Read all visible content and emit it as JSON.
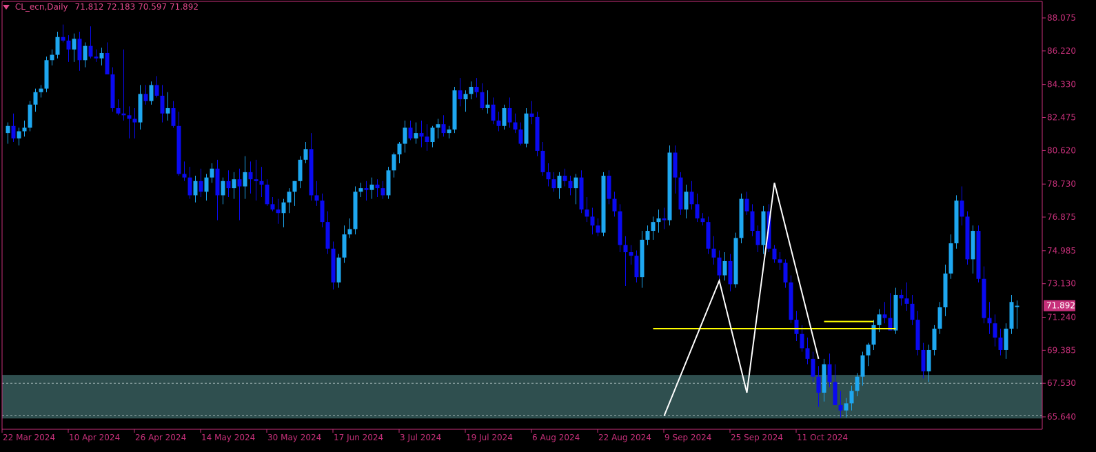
{
  "header": {
    "symbol": "CL_ecn,Daily",
    "open": "71.812",
    "high": "72.183",
    "low": "70.597",
    "close": "71.892"
  },
  "colors": {
    "background": "#000000",
    "axis": "#c7307a",
    "bull_candle": "#1ea7f0",
    "bear_candle": "#0a0af0",
    "zone_fill": "#2f4f4f",
    "zigzag": "#ffffff",
    "level_line": "#ffff00",
    "price_tag_bg": "#c7307a"
  },
  "chart_data": {
    "type": "candlestick",
    "y_ticks": [
      "88.075",
      "86.220",
      "84.330",
      "82.475",
      "80.620",
      "78.730",
      "76.875",
      "74.985",
      "73.130",
      "71.240",
      "69.385",
      "67.530",
      "65.640"
    ],
    "x_ticks": [
      {
        "label": "22 Mar 2024",
        "index": 0
      },
      {
        "label": "10 Apr 2024",
        "index": 12
      },
      {
        "label": "26 Apr 2024",
        "index": 24
      },
      {
        "label": "14 May 2024",
        "index": 36
      },
      {
        "label": "30 May 2024",
        "index": 48
      },
      {
        "label": "17 Jun 2024",
        "index": 60
      },
      {
        "label": "3 Jul 2024",
        "index": 72
      },
      {
        "label": "19 Jul 2024",
        "index": 84
      },
      {
        "label": "6 Aug 2024",
        "index": 96
      },
      {
        "label": "22 Aug 2024",
        "index": 108
      },
      {
        "label": "9 Sep 2024",
        "index": 120
      },
      {
        "label": "25 Sep 2024",
        "index": 132
      },
      {
        "label": "11 Oct 2024",
        "index": 144
      }
    ],
    "ylim": [
      65.0,
      88.8
    ],
    "current_price": "71.892",
    "demand_zone": {
      "top": 68.0,
      "bottom": 65.55,
      "dashed_levels": [
        67.53,
        65.7
      ]
    },
    "zigzag": [
      {
        "index": 119,
        "price": 65.7
      },
      {
        "index": 129,
        "price": 73.3
      },
      {
        "index": 134,
        "price": 67.0
      },
      {
        "index": 139,
        "price": 78.8
      },
      {
        "index": 147,
        "price": 68.9
      }
    ],
    "levels": [
      {
        "price": 70.6,
        "from_index": 117,
        "to_index": 161
      },
      {
        "price": 71.0,
        "from_index": 148,
        "to_index": 157
      }
    ],
    "candles": [
      [
        81.6,
        82.2,
        81.0,
        82.0
      ],
      [
        82.0,
        82.7,
        81.1,
        81.3
      ],
      [
        81.3,
        81.9,
        80.9,
        81.7
      ],
      [
        81.7,
        82.3,
        81.4,
        81.9
      ],
      [
        81.9,
        83.4,
        81.7,
        83.2
      ],
      [
        83.2,
        84.1,
        82.8,
        83.9
      ],
      [
        83.9,
        84.3,
        83.6,
        84.1
      ],
      [
        84.1,
        85.9,
        83.9,
        85.7
      ],
      [
        85.7,
        86.3,
        85.4,
        86.0
      ],
      [
        86.0,
        87.3,
        85.8,
        87.0
      ],
      [
        87.0,
        87.7,
        86.7,
        86.8
      ],
      [
        86.8,
        87.1,
        85.6,
        86.3
      ],
      [
        86.3,
        87.2,
        85.6,
        86.9
      ],
      [
        86.9,
        87.3,
        85.1,
        85.7
      ],
      [
        85.7,
        86.7,
        85.3,
        86.5
      ],
      [
        86.5,
        87.6,
        85.8,
        85.9
      ],
      [
        85.9,
        86.3,
        85.6,
        85.8
      ],
      [
        85.8,
        86.4,
        85.4,
        86.1
      ],
      [
        86.1,
        86.7,
        85.0,
        84.9
      ],
      [
        84.9,
        85.3,
        82.8,
        83.0
      ],
      [
        83.0,
        83.5,
        82.6,
        82.7
      ],
      [
        82.7,
        86.3,
        82.3,
        82.6
      ],
      [
        82.6,
        83.1,
        81.3,
        82.4
      ],
      [
        82.4,
        83.0,
        81.3,
        82.2
      ],
      [
        82.2,
        84.3,
        81.8,
        83.8
      ],
      [
        83.8,
        84.3,
        83.2,
        83.4
      ],
      [
        83.4,
        84.5,
        83.2,
        84.3
      ],
      [
        84.3,
        84.8,
        83.6,
        83.7
      ],
      [
        83.7,
        84.3,
        82.2,
        82.7
      ],
      [
        82.7,
        83.9,
        82.3,
        83.0
      ],
      [
        83.0,
        83.4,
        81.9,
        82.0
      ],
      [
        82.0,
        82.8,
        79.2,
        79.3
      ],
      [
        79.3,
        80.0,
        78.9,
        79.1
      ],
      [
        79.1,
        79.7,
        77.9,
        78.1
      ],
      [
        78.1,
        79.2,
        77.7,
        78.9
      ],
      [
        78.9,
        79.6,
        78.0,
        78.3
      ],
      [
        78.3,
        79.3,
        77.8,
        79.1
      ],
      [
        79.1,
        79.9,
        78.8,
        79.6
      ],
      [
        79.6,
        80.1,
        76.7,
        78.1
      ],
      [
        78.1,
        79.1,
        77.6,
        78.9
      ],
      [
        78.9,
        79.5,
        78.0,
        78.5
      ],
      [
        78.5,
        79.4,
        77.9,
        79.0
      ],
      [
        79.0,
        79.6,
        76.7,
        78.6
      ],
      [
        78.6,
        80.3,
        77.9,
        79.4
      ],
      [
        79.4,
        80.0,
        78.2,
        79.0
      ],
      [
        79.0,
        80.1,
        77.8,
        78.9
      ],
      [
        78.9,
        79.7,
        78.0,
        78.7
      ],
      [
        78.7,
        79.0,
        77.5,
        77.6
      ],
      [
        77.6,
        78.0,
        77.2,
        77.3
      ],
      [
        77.3,
        77.9,
        76.5,
        77.1
      ],
      [
        77.1,
        77.9,
        76.3,
        77.7
      ],
      [
        77.7,
        78.5,
        77.1,
        78.3
      ],
      [
        78.3,
        78.9,
        77.5,
        78.9
      ],
      [
        78.9,
        80.3,
        78.5,
        80.1
      ],
      [
        80.1,
        81.1,
        79.9,
        80.7
      ],
      [
        80.7,
        81.6,
        77.8,
        78.1
      ],
      [
        78.1,
        78.9,
        77.5,
        77.8
      ],
      [
        77.8,
        78.2,
        76.3,
        76.6
      ],
      [
        76.6,
        77.2,
        74.8,
        75.1
      ],
      [
        75.1,
        75.5,
        72.8,
        73.2
      ],
      [
        73.2,
        74.8,
        72.9,
        74.6
      ],
      [
        74.6,
        76.4,
        74.3,
        75.9
      ],
      [
        75.9,
        76.8,
        75.7,
        76.2
      ],
      [
        76.2,
        78.6,
        75.9,
        78.3
      ],
      [
        78.3,
        78.8,
        78.0,
        78.5
      ],
      [
        78.5,
        78.9,
        77.8,
        78.4
      ],
      [
        78.4,
        79.1,
        77.9,
        78.7
      ],
      [
        78.7,
        79.0,
        78.0,
        78.5
      ],
      [
        78.5,
        78.9,
        77.9,
        78.1
      ],
      [
        78.1,
        79.7,
        77.9,
        79.5
      ],
      [
        79.5,
        80.5,
        79.1,
        80.4
      ],
      [
        80.4,
        81.1,
        79.9,
        81.0
      ],
      [
        81.0,
        82.3,
        80.5,
        81.9
      ],
      [
        81.9,
        82.3,
        81.2,
        81.3
      ],
      [
        81.3,
        82.2,
        81.0,
        81.6
      ],
      [
        81.6,
        82.3,
        80.8,
        81.4
      ],
      [
        81.4,
        82.1,
        80.6,
        81.1
      ],
      [
        81.1,
        82.0,
        80.8,
        81.9
      ],
      [
        81.9,
        82.4,
        81.3,
        82.1
      ],
      [
        82.1,
        82.6,
        81.4,
        81.6
      ],
      [
        81.6,
        82.0,
        81.3,
        81.8
      ],
      [
        81.8,
        84.2,
        81.6,
        84.0
      ],
      [
        84.0,
        84.7,
        83.1,
        83.5
      ],
      [
        83.5,
        84.0,
        82.8,
        83.8
      ],
      [
        83.8,
        84.5,
        83.5,
        84.2
      ],
      [
        84.2,
        84.7,
        83.6,
        83.9
      ],
      [
        83.9,
        84.4,
        82.9,
        83.0
      ],
      [
        83.0,
        84.0,
        82.7,
        83.2
      ],
      [
        83.2,
        83.6,
        82.1,
        82.3
      ],
      [
        82.3,
        82.8,
        81.7,
        82.0
      ],
      [
        82.0,
        83.2,
        81.8,
        83.0
      ],
      [
        83.0,
        83.6,
        81.9,
        82.2
      ],
      [
        82.2,
        82.7,
        81.6,
        81.8
      ],
      [
        81.8,
        82.2,
        80.9,
        81.0
      ],
      [
        81.0,
        83.0,
        80.8,
        82.7
      ],
      [
        82.7,
        83.4,
        82.1,
        82.5
      ],
      [
        82.5,
        82.8,
        80.3,
        80.6
      ],
      [
        80.6,
        81.1,
        79.2,
        79.4
      ],
      [
        79.4,
        79.9,
        78.6,
        79.0
      ],
      [
        79.0,
        79.4,
        78.3,
        78.5
      ],
      [
        78.5,
        79.4,
        77.9,
        79.2
      ],
      [
        79.2,
        79.6,
        78.6,
        78.9
      ],
      [
        78.9,
        79.2,
        78.1,
        78.5
      ],
      [
        78.5,
        79.3,
        77.6,
        79.1
      ],
      [
        79.1,
        79.5,
        77.1,
        77.3
      ],
      [
        77.3,
        78.0,
        76.6,
        76.9
      ],
      [
        76.9,
        77.4,
        75.9,
        76.4
      ],
      [
        76.4,
        76.8,
        75.8,
        76.0
      ],
      [
        76.0,
        79.4,
        75.8,
        79.2
      ],
      [
        79.2,
        79.5,
        77.6,
        77.9
      ],
      [
        77.9,
        78.3,
        76.9,
        77.2
      ],
      [
        77.2,
        77.6,
        74.9,
        75.3
      ],
      [
        75.3,
        75.8,
        73.0,
        74.9
      ],
      [
        74.9,
        75.3,
        74.2,
        74.7
      ],
      [
        74.7,
        75.0,
        73.2,
        73.5
      ],
      [
        73.5,
        76.1,
        72.9,
        75.6
      ],
      [
        75.6,
        76.4,
        75.3,
        76.1
      ],
      [
        76.1,
        76.9,
        75.6,
        76.6
      ],
      [
        76.6,
        77.3,
        76.0,
        76.8
      ],
      [
        76.8,
        77.4,
        76.2,
        76.7
      ],
      [
        76.7,
        80.9,
        76.4,
        80.5
      ],
      [
        80.5,
        80.9,
        78.2,
        79.1
      ],
      [
        79.1,
        79.4,
        77.0,
        77.3
      ],
      [
        77.3,
        78.7,
        76.8,
        78.3
      ],
      [
        78.3,
        78.9,
        77.3,
        77.6
      ],
      [
        77.6,
        78.2,
        76.6,
        76.8
      ],
      [
        76.8,
        77.1,
        76.4,
        76.6
      ],
      [
        76.6,
        76.9,
        74.8,
        75.1
      ],
      [
        75.1,
        75.8,
        74.2,
        74.6
      ],
      [
        74.6,
        75.0,
        73.2,
        73.6
      ],
      [
        73.6,
        74.9,
        73.3,
        74.4
      ],
      [
        74.4,
        74.8,
        72.7,
        73.1
      ],
      [
        73.1,
        76.0,
        72.9,
        75.7
      ],
      [
        75.7,
        78.2,
        75.4,
        77.9
      ],
      [
        77.9,
        78.3,
        77.0,
        77.2
      ],
      [
        77.2,
        77.6,
        75.8,
        76.1
      ],
      [
        76.1,
        76.4,
        74.9,
        75.3
      ],
      [
        75.3,
        77.5,
        74.8,
        77.2
      ],
      [
        77.2,
        77.6,
        74.9,
        75.1
      ],
      [
        75.1,
        75.3,
        74.3,
        74.5
      ],
      [
        74.5,
        74.9,
        73.9,
        74.3
      ],
      [
        74.3,
        74.5,
        72.9,
        73.2
      ],
      [
        73.2,
        73.6,
        70.9,
        71.1
      ],
      [
        71.1,
        71.6,
        69.9,
        70.3
      ],
      [
        70.3,
        70.8,
        69.3,
        69.5
      ],
      [
        69.5,
        70.1,
        68.6,
        68.9
      ],
      [
        68.9,
        69.3,
        67.6,
        67.9
      ],
      [
        67.9,
        68.5,
        66.2,
        67.0
      ],
      [
        67.0,
        68.9,
        66.5,
        68.6
      ],
      [
        68.6,
        69.2,
        67.3,
        67.6
      ],
      [
        67.6,
        68.6,
        66.6,
        66.3
      ],
      [
        66.3,
        67.1,
        65.6,
        66.0
      ],
      [
        66.0,
        66.7,
        65.6,
        66.4
      ],
      [
        66.4,
        67.4,
        66.0,
        67.1
      ],
      [
        67.1,
        68.1,
        66.8,
        67.9
      ],
      [
        67.9,
        69.3,
        67.4,
        69.1
      ],
      [
        69.1,
        69.8,
        68.5,
        69.7
      ],
      [
        69.7,
        71.1,
        69.4,
        70.8
      ],
      [
        70.8,
        71.7,
        70.4,
        71.4
      ],
      [
        71.4,
        72.1,
        70.9,
        71.2
      ],
      [
        71.2,
        72.6,
        70.6,
        70.5
      ],
      [
        70.5,
        72.9,
        70.3,
        72.5
      ],
      [
        72.5,
        72.8,
        71.9,
        72.3
      ],
      [
        72.3,
        73.2,
        71.6,
        72.0
      ],
      [
        72.0,
        72.5,
        70.8,
        71.1
      ],
      [
        71.1,
        71.6,
        69.1,
        69.4
      ],
      [
        69.4,
        69.8,
        67.8,
        68.2
      ],
      [
        68.2,
        69.7,
        67.6,
        69.4
      ],
      [
        69.4,
        70.8,
        69.1,
        70.6
      ],
      [
        70.6,
        72.1,
        70.3,
        71.8
      ],
      [
        71.8,
        74.2,
        71.3,
        73.7
      ],
      [
        73.7,
        75.9,
        73.4,
        75.4
      ],
      [
        75.4,
        78.1,
        75.1,
        77.8
      ],
      [
        77.8,
        78.6,
        76.4,
        76.9
      ],
      [
        76.9,
        77.2,
        74.2,
        74.5
      ],
      [
        74.5,
        76.4,
        73.7,
        76.1
      ],
      [
        76.1,
        76.4,
        73.2,
        73.4
      ],
      [
        73.4,
        74.1,
        70.9,
        71.2
      ],
      [
        71.2,
        72.1,
        70.3,
        70.9
      ],
      [
        70.9,
        71.4,
        69.6,
        70.1
      ],
      [
        70.1,
        70.6,
        69.1,
        69.4
      ],
      [
        69.4,
        70.9,
        68.9,
        70.6
      ],
      [
        70.6,
        72.5,
        70.3,
        72.1
      ],
      [
        71.812,
        72.183,
        70.597,
        71.892
      ]
    ]
  }
}
